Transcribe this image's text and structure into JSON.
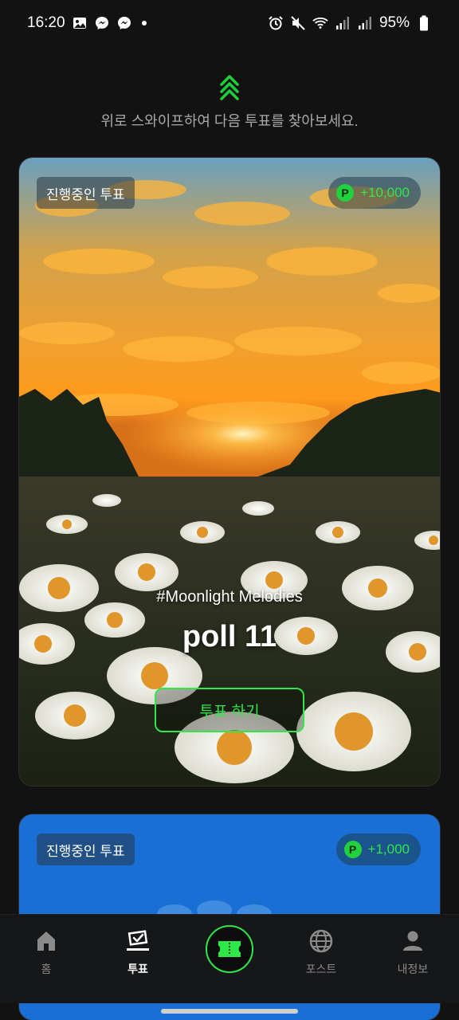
{
  "status_bar": {
    "time": "16:20",
    "battery": "95%",
    "left_icons": [
      "image-icon",
      "messenger-icon",
      "messenger-icon"
    ],
    "right_icons": [
      "alarm-icon",
      "mute-icon",
      "wifi-icon",
      "signal-icon",
      "signal-icon",
      "battery-icon"
    ]
  },
  "swipe_hint": {
    "text": "위로 스와이프하여 다음 투표를 찾아보세요.",
    "icon": "chevrons-up-icon",
    "color": "#1fcf3a"
  },
  "cards": [
    {
      "status": "진행중인 투표",
      "reward": "+10,000",
      "reward_icon": "p-coin-icon",
      "hashtag": "#Moonlight Melodies",
      "title": "poll 11",
      "vote_label": "투표 하기",
      "image": "sunset-daisy-field"
    },
    {
      "status": "진행중인 투표",
      "reward": "+1,000",
      "reward_icon": "p-coin-icon",
      "image": "blue-poster"
    }
  ],
  "bottom_nav": {
    "items": [
      {
        "label": "홈",
        "icon": "home-icon",
        "active": false
      },
      {
        "label": "투표",
        "icon": "vote-icon",
        "active": true
      },
      {
        "label": "",
        "icon": "ticket-icon",
        "active": false
      },
      {
        "label": "포스트",
        "icon": "globe-icon",
        "active": false
      },
      {
        "label": "내정보",
        "icon": "user-icon",
        "active": false
      }
    ]
  },
  "colors": {
    "accent": "#2ee84a",
    "background": "#121212",
    "nav_background": "#161719"
  }
}
